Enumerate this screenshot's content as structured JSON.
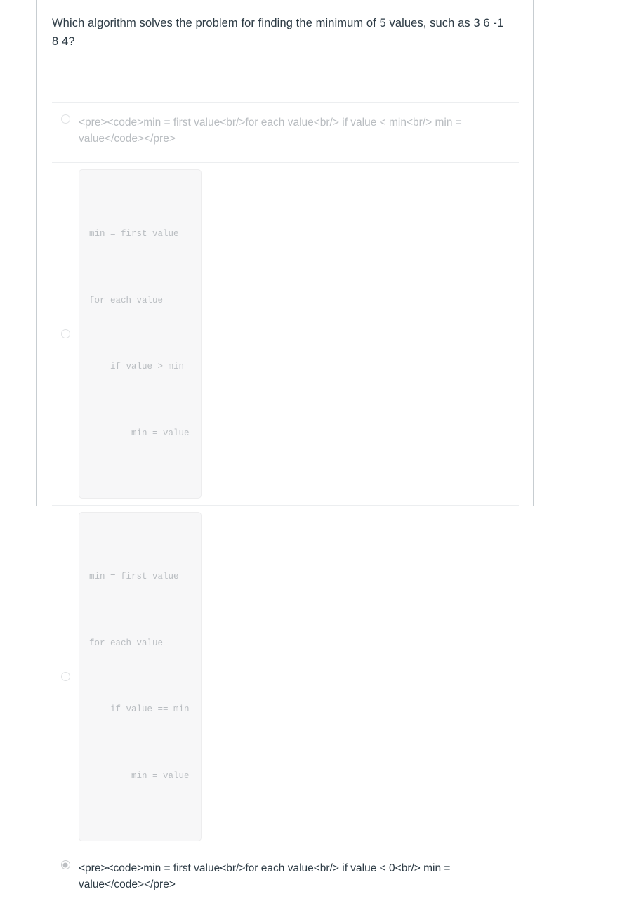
{
  "question": {
    "text": "Which algorithm solves the problem for finding the minimum of 5 values, such as 3 6 -1 8 4?"
  },
  "answers": [
    {
      "id": "answer-1",
      "kind": "raw-markup",
      "selected": false,
      "text": "<pre><code>min = first value<br/>for each value<br/> if value < min<br/> min = value</code></pre>"
    },
    {
      "id": "answer-2",
      "kind": "code-block",
      "selected": false,
      "lines": [
        "min = first value",
        "for each value",
        "    if value > min",
        "        min = value"
      ]
    },
    {
      "id": "answer-3",
      "kind": "code-block",
      "selected": false,
      "lines": [
        "min = first value",
        "for each value",
        "    if value == min",
        "        min = value"
      ]
    },
    {
      "id": "answer-4",
      "kind": "raw-markup",
      "selected": true,
      "text": "<pre><code>min = first value<br/>for each value<br/> if value < 0<br/> min = value</code></pre>"
    }
  ]
}
